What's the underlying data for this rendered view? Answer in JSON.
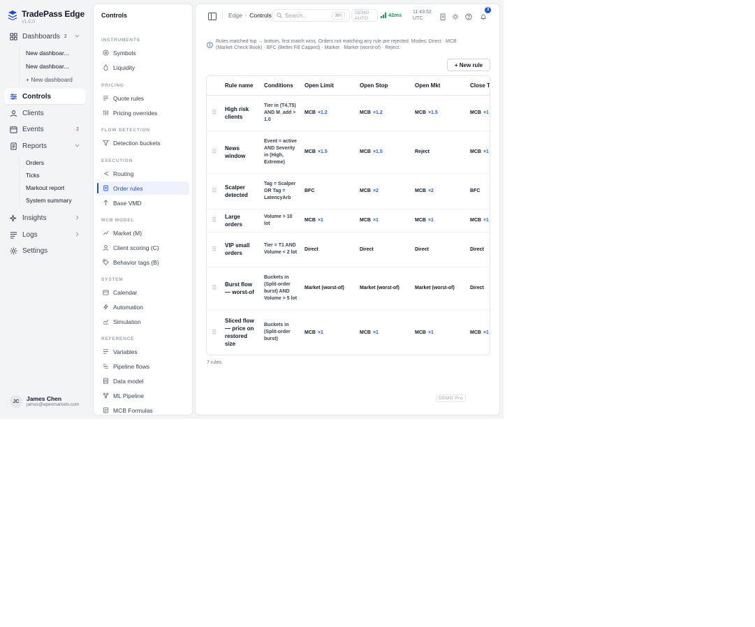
{
  "brand": {
    "name": "TradePass Edge",
    "version": "v1.0.0"
  },
  "nav": {
    "dashboards": {
      "label": "Dashboards",
      "count": "2",
      "items": [
        "New dashboar...",
        "New dashboar..."
      ],
      "add_label": "+ New dashboard"
    },
    "controls": {
      "label": "Controls"
    },
    "clients": {
      "label": "Clients"
    },
    "events": {
      "label": "Events",
      "badge": "2"
    },
    "reports": {
      "label": "Reports",
      "items": [
        "Orders",
        "Ticks",
        "Markout report",
        "System summary"
      ]
    },
    "insights": {
      "label": "Insights"
    },
    "logs": {
      "label": "Logs"
    },
    "settings": {
      "label": "Settings"
    }
  },
  "user": {
    "initials": "JC",
    "name": "James Chen",
    "email": "james@apexmarkets.com"
  },
  "controls_panel": {
    "title": "Controls",
    "sections": [
      {
        "label": "INSTRUMENTS",
        "items": [
          {
            "label": "Symbols",
            "icon": "circle-icon"
          },
          {
            "label": "Liquidity",
            "icon": "drop-icon"
          }
        ]
      },
      {
        "label": "PRICING",
        "items": [
          {
            "label": "Quote rules",
            "icon": "lines-icon"
          },
          {
            "label": "Pricing overrides",
            "icon": "sliders-icon"
          }
        ]
      },
      {
        "label": "FLOW DETECTION",
        "items": [
          {
            "label": "Detection buckets",
            "icon": "filter-icon"
          }
        ]
      },
      {
        "label": "EXECUTION",
        "items": [
          {
            "label": "Routing",
            "icon": "split-icon"
          },
          {
            "label": "Order rules",
            "icon": "document-icon",
            "active": true
          },
          {
            "label": "Base VMD",
            "icon": "arrow-up-icon"
          }
        ]
      },
      {
        "label": "MCB MODEL",
        "items": [
          {
            "label": "Market (M)",
            "icon": "trend-icon"
          },
          {
            "label": "Client scoring (C)",
            "icon": "user-icon"
          },
          {
            "label": "Behavior tags (B)",
            "icon": "tag-icon"
          }
        ]
      },
      {
        "label": "SYSTEM",
        "items": [
          {
            "label": "Calendar",
            "icon": "calendar-icon"
          },
          {
            "label": "Automation",
            "icon": "bolt-icon"
          },
          {
            "label": "Simulation",
            "icon": "chart-line-icon"
          }
        ]
      },
      {
        "label": "REFERENCE",
        "items": [
          {
            "label": "Variables",
            "icon": "lines-icon"
          },
          {
            "label": "Pipeline flows",
            "icon": "flow-icon"
          },
          {
            "label": "Data model",
            "icon": "database-icon"
          },
          {
            "label": "ML Pipeline",
            "icon": "network-icon"
          },
          {
            "label": "MCB Formulas",
            "icon": "formula-icon"
          }
        ]
      }
    ]
  },
  "topbar": {
    "breadcrumb": {
      "root": "Edge",
      "current": "Controls"
    },
    "search_placeholder": "Search...",
    "search_shortcut": "⌘K",
    "demo_line1": "DEMO ·",
    "demo_line2": "AUTO",
    "latency": "42ms",
    "time": "11:43:52",
    "timezone": "UTC",
    "notifications": "3"
  },
  "info_text": "Rules matched top → bottom, first match wins. Orders not matching any rule are rejected. Modes: Direct · MCB (Market·Check·Book) · BFC (Better Fill Capped) · Market · Market (worst-of) · Reject.",
  "new_rule_label": "+ New rule",
  "table": {
    "columns": [
      "Rule name",
      "Conditions",
      "Open Limit",
      "Open Stop",
      "Open Mkt",
      "Close T"
    ],
    "rows": [
      {
        "name": "High risk clients",
        "conditions": "Tier in (T4,T5) AND M_add > 1.0",
        "cells": [
          {
            "mode": "MCB",
            "mult": "×1.2"
          },
          {
            "mode": "MCB",
            "mult": "×1.2"
          },
          {
            "mode": "MCB",
            "mult": "×1.5"
          },
          {
            "mode": "MCB",
            "mult": "×1"
          }
        ]
      },
      {
        "name": "News window",
        "conditions": "Event = active AND Severity in (High, Extreme)",
        "cells": [
          {
            "mode": "MCB",
            "mult": "×1.5"
          },
          {
            "mode": "MCB",
            "mult": "×1.5"
          },
          {
            "mode": "Reject",
            "mult": ""
          },
          {
            "mode": "MCB",
            "mult": "×1"
          }
        ]
      },
      {
        "name": "Scalper detected",
        "conditions": "Tag = Scalper OR Tag = LatencyArb",
        "cells": [
          {
            "mode": "BFC",
            "mult": ""
          },
          {
            "mode": "MCB",
            "mult": "×2"
          },
          {
            "mode": "MCB",
            "mult": "×2"
          },
          {
            "mode": "BFC",
            "mult": ""
          }
        ]
      },
      {
        "name": "Large orders",
        "conditions": "Volume > 10 lot",
        "cells": [
          {
            "mode": "MCB",
            "mult": "×1"
          },
          {
            "mode": "MCB",
            "mult": "×1"
          },
          {
            "mode": "MCB",
            "mult": "×1"
          },
          {
            "mode": "MCB",
            "mult": "×1"
          }
        ]
      },
      {
        "name": "VIP small orders",
        "conditions": "Tier = T1 AND Volume < 2 lot",
        "cells": [
          {
            "mode": "Direct",
            "mult": ""
          },
          {
            "mode": "Direct",
            "mult": ""
          },
          {
            "mode": "Direct",
            "mult": ""
          },
          {
            "mode": "Direct",
            "mult": ""
          }
        ]
      },
      {
        "name": "Burst flow — worst-of",
        "conditions": "Buckets in (Split-order burst) AND Volume > 5 lot",
        "cells": [
          {
            "mode": "Market (worst-of)",
            "mult": ""
          },
          {
            "mode": "Market (worst-of)",
            "mult": ""
          },
          {
            "mode": "Market (worst-of)",
            "mult": ""
          },
          {
            "mode": "Direct",
            "mult": ""
          }
        ]
      },
      {
        "name": "Sliced flow — price on restored size",
        "conditions": "Buckets in (Split-order burst)",
        "cells": [
          {
            "mode": "MCB",
            "mult": "×1"
          },
          {
            "mode": "MCB",
            "mult": "×1"
          },
          {
            "mode": "MCB",
            "mult": "×1"
          },
          {
            "mode": "MCB",
            "mult": "×1"
          }
        ]
      }
    ]
  },
  "rule_count": "7 rules",
  "demo_tag": "DEMO Pro",
  "colors": {
    "accent": "#1d4ed8",
    "multiplier": "#2563eb",
    "latency": "#16a34a",
    "badge": "#dc2626"
  }
}
